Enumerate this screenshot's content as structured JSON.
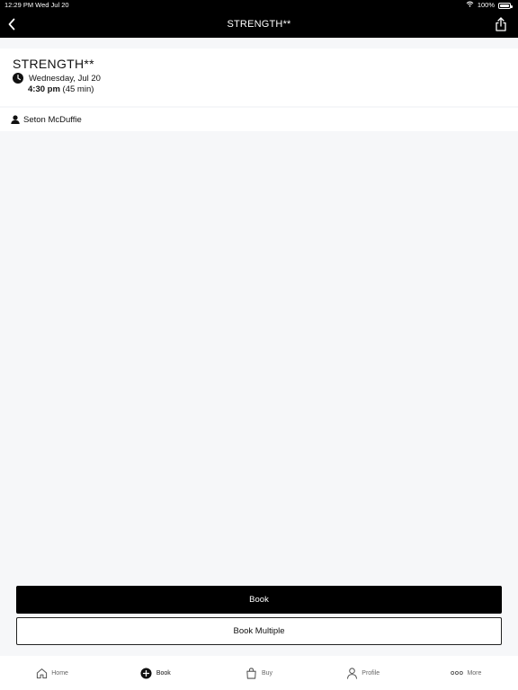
{
  "status_bar": {
    "time_date": "12:29 PM  Wed Jul 20",
    "battery": "100%"
  },
  "nav": {
    "title": "STRENGTH**"
  },
  "class": {
    "title": "STRENGTH**",
    "date": "Wednesday, Jul 20",
    "time": "4:30 pm",
    "duration": "(45 min)"
  },
  "instructor": {
    "name": "Seton McDuffie"
  },
  "actions": {
    "book_label": "Book",
    "book_multiple_label": "Book Multiple"
  },
  "tabbar": {
    "items": [
      {
        "label": "Home",
        "icon": "home-icon"
      },
      {
        "label": "Book",
        "icon": "plus-circle-icon"
      },
      {
        "label": "Buy",
        "icon": "shopping-bag-icon"
      },
      {
        "label": "Profile",
        "icon": "person-icon"
      },
      {
        "label": "More",
        "icon": "more-dots-icon"
      }
    ],
    "active": "Book"
  },
  "colors": {
    "primary": "#000000",
    "background": "#f6f7f9",
    "card": "#ffffff"
  }
}
